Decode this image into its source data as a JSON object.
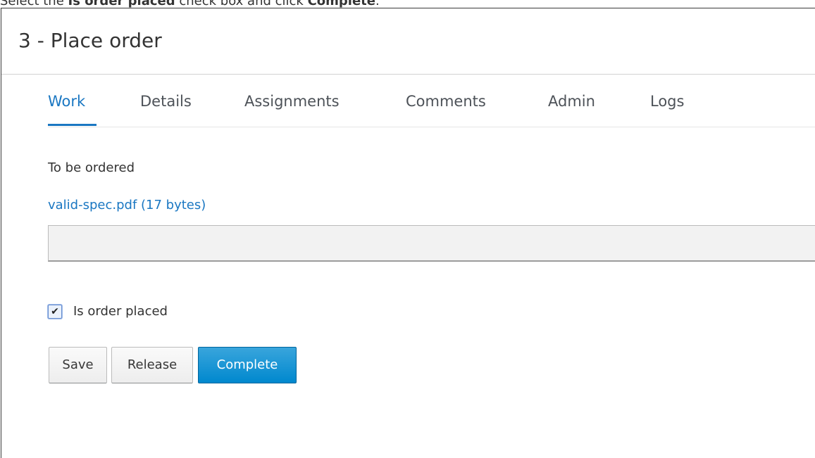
{
  "caption": {
    "prefix": "Select the ",
    "bold_1": "Is order placed",
    "middle": " check box and click ",
    "bold_2": "Complete",
    "suffix": "."
  },
  "panel": {
    "title": "3 - Place order"
  },
  "tabs": [
    {
      "label": "Work",
      "active": true
    },
    {
      "label": "Details",
      "active": false
    },
    {
      "label": "Assignments",
      "active": false
    },
    {
      "label": "Comments",
      "active": false
    },
    {
      "label": "Admin",
      "active": false
    },
    {
      "label": "Logs",
      "active": false
    }
  ],
  "form": {
    "section_label": "To be ordered",
    "file_link": "valid-spec.pdf (17 bytes)",
    "input_value": "",
    "checkbox_label": "Is order placed",
    "checkbox_checked": true
  },
  "buttons": {
    "save": "Save",
    "release": "Release",
    "complete": "Complete"
  },
  "colors": {
    "link_blue": "#1a77c2",
    "primary_button": "#0088ce"
  }
}
